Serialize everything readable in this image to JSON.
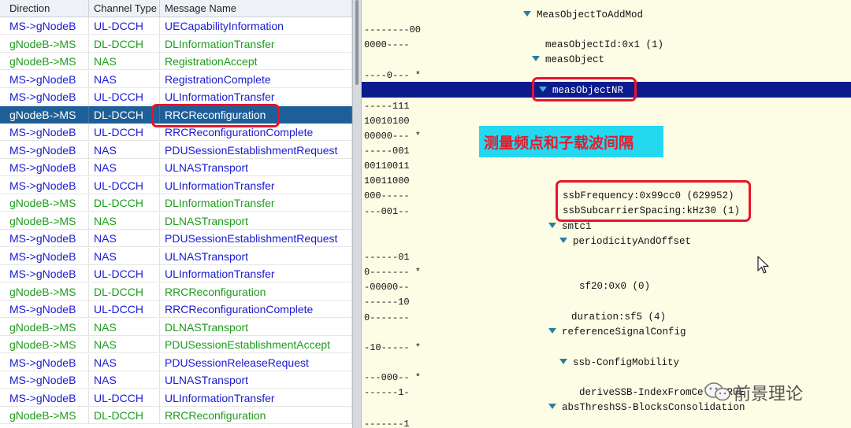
{
  "message_list": {
    "columns": [
      "Direction",
      "Channel Type",
      "Message Name"
    ],
    "rows": [
      {
        "dir": "MS->gNodeB",
        "ch": "UL-DCCH",
        "msg": "UECapabilityInformation",
        "color": "#1a1ad4",
        "selected": false
      },
      {
        "dir": "gNodeB->MS",
        "ch": "DL-DCCH",
        "msg": "DLInformationTransfer",
        "color": "#1e9c1e",
        "selected": false
      },
      {
        "dir": "gNodeB->MS",
        "ch": "NAS",
        "msg": "RegistrationAccept",
        "color": "#1e9c1e",
        "selected": false
      },
      {
        "dir": "MS->gNodeB",
        "ch": "NAS",
        "msg": "RegistrationComplete",
        "color": "#1a1ad4",
        "selected": false
      },
      {
        "dir": "MS->gNodeB",
        "ch": "UL-DCCH",
        "msg": "ULInformationTransfer",
        "color": "#1a1ad4",
        "selected": false
      },
      {
        "dir": "gNodeB->MS",
        "ch": "DL-DCCH",
        "msg": "RRCReconfiguration",
        "color": "#ffffff",
        "selected": true
      },
      {
        "dir": "MS->gNodeB",
        "ch": "UL-DCCH",
        "msg": "RRCReconfigurationComplete",
        "color": "#1a1ad4",
        "selected": false
      },
      {
        "dir": "MS->gNodeB",
        "ch": "NAS",
        "msg": "PDUSessionEstablishmentRequest",
        "color": "#1a1ad4",
        "selected": false
      },
      {
        "dir": "MS->gNodeB",
        "ch": "NAS",
        "msg": "ULNASTransport",
        "color": "#1a1ad4",
        "selected": false
      },
      {
        "dir": "MS->gNodeB",
        "ch": "UL-DCCH",
        "msg": "ULInformationTransfer",
        "color": "#1a1ad4",
        "selected": false
      },
      {
        "dir": "gNodeB->MS",
        "ch": "DL-DCCH",
        "msg": "DLInformationTransfer",
        "color": "#1e9c1e",
        "selected": false
      },
      {
        "dir": "gNodeB->MS",
        "ch": "NAS",
        "msg": "DLNASTransport",
        "color": "#1e9c1e",
        "selected": false
      },
      {
        "dir": "MS->gNodeB",
        "ch": "NAS",
        "msg": "PDUSessionEstablishmentRequest",
        "color": "#1a1ad4",
        "selected": false
      },
      {
        "dir": "MS->gNodeB",
        "ch": "NAS",
        "msg": "ULNASTransport",
        "color": "#1a1ad4",
        "selected": false
      },
      {
        "dir": "MS->gNodeB",
        "ch": "UL-DCCH",
        "msg": "ULInformationTransfer",
        "color": "#1a1ad4",
        "selected": false
      },
      {
        "dir": "gNodeB->MS",
        "ch": "DL-DCCH",
        "msg": "RRCReconfiguration",
        "color": "#1e9c1e",
        "selected": false
      },
      {
        "dir": "MS->gNodeB",
        "ch": "UL-DCCH",
        "msg": "RRCReconfigurationComplete",
        "color": "#1a1ad4",
        "selected": false
      },
      {
        "dir": "gNodeB->MS",
        "ch": "NAS",
        "msg": "DLNASTransport",
        "color": "#1e9c1e",
        "selected": false
      },
      {
        "dir": "gNodeB->MS",
        "ch": "NAS",
        "msg": "PDUSessionEstablishmentAccept",
        "color": "#1e9c1e",
        "selected": false
      },
      {
        "dir": "MS->gNodeB",
        "ch": "NAS",
        "msg": "PDUSessionReleaseRequest",
        "color": "#1a1ad4",
        "selected": false
      },
      {
        "dir": "MS->gNodeB",
        "ch": "NAS",
        "msg": "ULNASTransport",
        "color": "#1a1ad4",
        "selected": false
      },
      {
        "dir": "MS->gNodeB",
        "ch": "UL-DCCH",
        "msg": "ULInformationTransfer",
        "color": "#1a1ad4",
        "selected": false
      },
      {
        "dir": "gNodeB->MS",
        "ch": "DL-DCCH",
        "msg": "RRCReconfiguration",
        "color": "#1e9c1e",
        "selected": false
      }
    ]
  },
  "decode_panel": {
    "hex_lines": [
      "--------00",
      "0000----",
      "----0--- *",
      "-----111",
      "10010100",
      "00000--- *",
      "-----001",
      "00110011",
      "10011000",
      "000-----",
      "---001--",
      "------01",
      "0------- *",
      "-00000--",
      "------10",
      "0-------",
      "-10----- *",
      "---000-- *",
      "------1-",
      "-------1"
    ],
    "tree_lines": [
      {
        "text": "MeasObjectToAddMod",
        "expander": true
      },
      {
        "text": "measObjectId:0x1 (1)",
        "expander": false
      },
      {
        "text": "measObject",
        "expander": true
      },
      {
        "text": "measObjectNR",
        "expander": true,
        "selected": true
      },
      {
        "text": "ssbFrequency:0x99cc0 (629952)",
        "expander": false
      },
      {
        "text": "ssbSubcarrierSpacing:kHz30 (1)",
        "expander": false
      },
      {
        "text": "smtc1",
        "expander": true
      },
      {
        "text": "periodicityAndOffset",
        "expander": true
      },
      {
        "text": "sf20:0x0 (0)",
        "expander": false
      },
      {
        "text": "duration:sf5 (4)",
        "expander": false
      },
      {
        "text": "referenceSignalConfig",
        "expander": true
      },
      {
        "text": "ssb-ConfigMobility",
        "expander": true
      },
      {
        "text": "deriveSSB-IndexFromCell:TRUE",
        "expander": false
      },
      {
        "text": "absThreshSS-BlocksConsolidation",
        "expander": true
      }
    ]
  },
  "annotation": {
    "callout_text": "测量频点和子载波间隔",
    "colors": {
      "callout_bg": "#24d8f0",
      "callout_text": "#e41c2a",
      "highlight_box": "#e8142a",
      "selection_row": "#1f5f98",
      "selection_tree": "#0c1c8c"
    }
  },
  "watermark": {
    "text": "前景理论",
    "icon": "wechat-icon"
  }
}
